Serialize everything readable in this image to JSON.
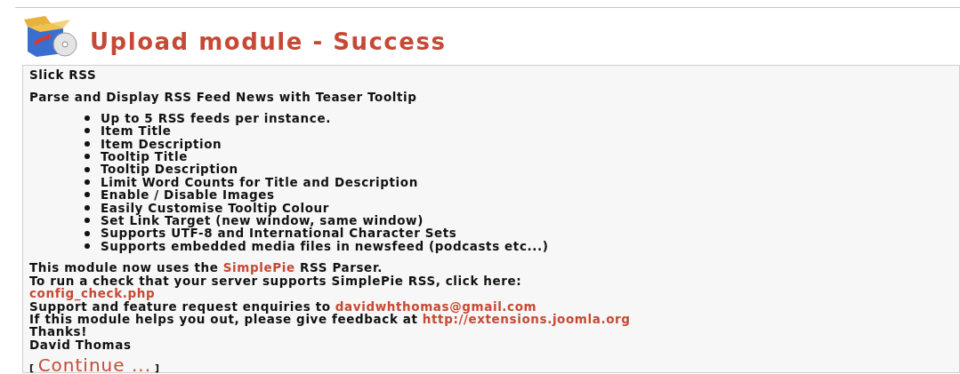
{
  "title": "Upload module - Success",
  "module_name": "Slick RSS",
  "description": "Parse and Display RSS Feed News with Teaser Tooltip",
  "features": [
    "Up to 5 RSS feeds per instance.",
    "Item Title",
    "Item Description",
    "Tooltip Title",
    "Tooltip Description",
    "Limit Word Counts for Title and Description",
    "Enable / Disable Images",
    "Easily Customise Tooltip Colour",
    "Set Link Target (new window, same window)",
    "Supports UTF-8 and International Character Sets",
    "Supports embedded media files in newsfeed (podcasts etc...)"
  ],
  "lines": [
    [
      {
        "kind": "text",
        "text": "This module now uses the "
      },
      {
        "kind": "link",
        "text": "SimplePie"
      },
      {
        "kind": "text",
        "text": " RSS Parser."
      }
    ],
    [
      {
        "kind": "text",
        "text": "To run a check that your server supports SimplePie RSS, click here:"
      }
    ],
    [
      {
        "kind": "link",
        "text": "config_check.php"
      }
    ],
    [
      {
        "kind": "text",
        "text": "Support and feature request enquiries to "
      },
      {
        "kind": "link",
        "text": "davidwhthomas@gmail.com"
      }
    ],
    [
      {
        "kind": "text",
        "text": "If this module helps you out, please give feedback at "
      },
      {
        "kind": "link",
        "text": "http://extensions.joomla.org"
      }
    ],
    [
      {
        "kind": "text",
        "text": "Thanks!"
      }
    ],
    [
      {
        "kind": "text",
        "text": "David Thomas"
      }
    ]
  ],
  "continue": {
    "open": "[",
    "label": "Continue ...",
    "close": "]"
  }
}
